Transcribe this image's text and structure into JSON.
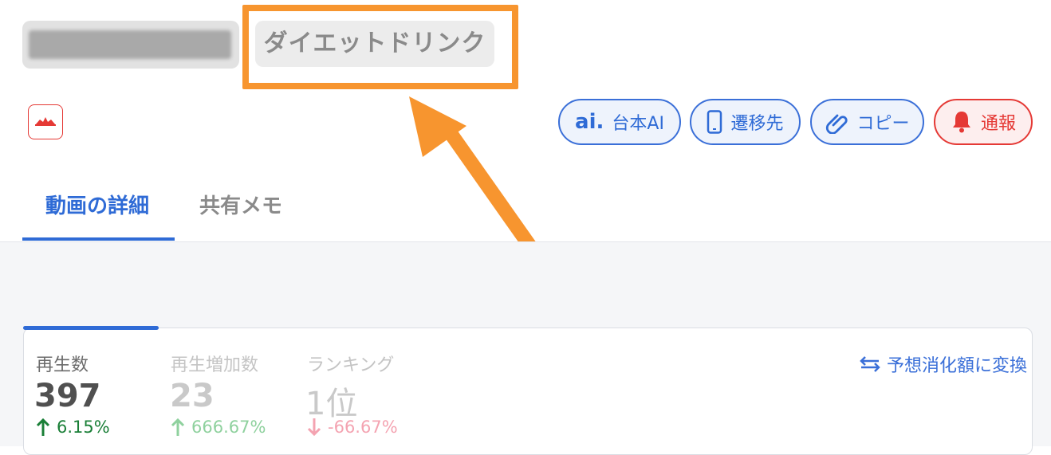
{
  "header": {
    "category_tag": "ダイエットドリンク"
  },
  "actions": {
    "script_ai_label": "台本AI",
    "destination_label": "遷移先",
    "copy_label": "コピー",
    "report_label": "通報"
  },
  "tabs": {
    "details_label": "動画の詳細",
    "shared_memo_label": "共有メモ"
  },
  "stats": [
    {
      "label": "再生数",
      "value": "397",
      "change": "6.15%",
      "direction": "up",
      "color": "#1a7f37"
    },
    {
      "label": "再生増加数",
      "value": "23",
      "change": "666.67%",
      "direction": "up",
      "color": "#8fd19e"
    },
    {
      "label": "ランキング",
      "value": "1位",
      "change": "-66.67%",
      "direction": "down",
      "color": "#f4a3b1"
    }
  ],
  "convert_label": "予想消化額に変換",
  "colors": {
    "accent_blue": "#2f6bd6",
    "alert_red": "#e53935",
    "highlight_orange": "#f7952f"
  }
}
